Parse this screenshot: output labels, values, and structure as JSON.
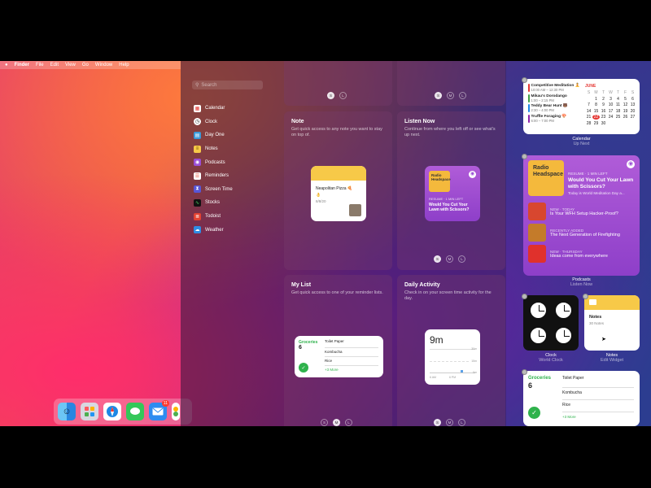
{
  "menubar": {
    "apple": "",
    "items": [
      "Finder",
      "File",
      "Edit",
      "View",
      "Go",
      "Window",
      "Help"
    ]
  },
  "sidebar": {
    "search_placeholder": "Search",
    "items": [
      {
        "label": "Calendar",
        "icon": "calendar-icon",
        "color": "#f4f4f4"
      },
      {
        "label": "Clock",
        "icon": "clock-icon",
        "color": "#111111"
      },
      {
        "label": "Day One",
        "icon": "day-one-icon",
        "color": "#3a9ad9"
      },
      {
        "label": "Notes",
        "icon": "notes-icon",
        "color": "#f7c948"
      },
      {
        "label": "Podcasts",
        "icon": "podcasts-icon",
        "color": "#9b4fd6"
      },
      {
        "label": "Reminders",
        "icon": "reminders-icon",
        "color": "#ffffff"
      },
      {
        "label": "Screen Time",
        "icon": "hourglass-icon",
        "color": "#5856d6"
      },
      {
        "label": "Stocks",
        "icon": "stocks-icon",
        "color": "#111111"
      },
      {
        "label": "Todoist",
        "icon": "todoist-icon",
        "color": "#e44332"
      },
      {
        "label": "Weather",
        "icon": "weather-icon",
        "color": "#2f8de4"
      }
    ]
  },
  "sizes": {
    "s": "S",
    "m": "M",
    "l": "L"
  },
  "panels": {
    "note": {
      "title": "Note",
      "desc": "Get quick access to any note you want to stay on top of."
    },
    "listen": {
      "title": "Listen Now",
      "desc": "Continue from where you left off or see what's up next."
    },
    "mylist": {
      "title": "My List",
      "desc": "Get quick access to one of your reminder lists."
    },
    "activity": {
      "title": "Daily Activity",
      "desc": "Check in on your screen time activity for the day."
    }
  },
  "note_widget": {
    "title": "Neapolitan Pizza 🍕",
    "emoji": "👌",
    "date": "8/8/20"
  },
  "listen_widget": {
    "meta": "RESUME · 1 MIN LEFT",
    "title": "Would You Cut Your Lawn with Scissors?",
    "art": "Radio Headspace"
  },
  "list_widget": {
    "name": "Groceries",
    "count": "6",
    "items": [
      "Toilet Paper",
      "Kombucha",
      "Rice"
    ],
    "more": "+3 More"
  },
  "activity_widget": {
    "value": "9m",
    "ticks": [
      "30m",
      "15m",
      "0m"
    ],
    "times": [
      "6 AM",
      "6 PM"
    ]
  },
  "calendar_widget": {
    "month": "JUNE",
    "weekdays": [
      "S",
      "M",
      "T",
      "W",
      "T",
      "F",
      "S"
    ],
    "days": [
      "",
      "1",
      "2",
      "3",
      "4",
      "5",
      "6",
      "7",
      "8",
      "9",
      "10",
      "11",
      "12",
      "13",
      "14",
      "15",
      "16",
      "17",
      "18",
      "19",
      "20",
      "21",
      "22",
      "23",
      "24",
      "25",
      "26",
      "27",
      "28",
      "29",
      "30",
      "",
      "",
      "",
      ""
    ],
    "today": "22",
    "events": [
      {
        "title": "Competitive Meditation 🧘",
        "time": "10:00 AM – 12:30 PM",
        "color": "#e53935"
      },
      {
        "title": "Mikau's Dorodango",
        "time": "1:00 – 2:15 PM",
        "color": "#43a047"
      },
      {
        "title": "Teddy Bear Hunt 🐻",
        "time": "2:30 – 4:00 PM",
        "color": "#1e88e5"
      },
      {
        "title": "Truffle Foraging 🍄",
        "time": "6:00 – 7:00 PM",
        "color": "#8e24aa"
      }
    ],
    "caption": "Calendar",
    "sub": "Up Next"
  },
  "podcasts_widget": {
    "art": "Radio Headspace",
    "top_meta": "RESUME · 1 MIN LEFT",
    "top_title": "Would You Cut Your Lawn with Scissors?",
    "top_sub": "Today is World Meditation Day a...",
    "rows": [
      {
        "meta": "NEW · TODAY",
        "title": "Is Your WFH Setup Hacker-Proof?",
        "color": "#d8472f"
      },
      {
        "meta": "RECENTLY ADDED",
        "title": "The Next Generation of Firefighting",
        "color": "#c47b2a"
      },
      {
        "meta": "NEW · THURSDAY",
        "title": "Ideas come from everywhere",
        "color": "#e0312c"
      }
    ],
    "caption": "Podcasts",
    "sub": "Listen Now"
  },
  "clock_widget": {
    "caption": "Clock",
    "sub": "World Clock"
  },
  "notes_widget": {
    "title": "Notes",
    "count": "30 Notes",
    "caption": "Notes",
    "sub": "Edit Widget"
  },
  "reminders_widget": {
    "name": "Groceries",
    "count": "6",
    "items": [
      "Toilet Paper",
      "Kombucha",
      "Rice"
    ],
    "more": "+3 More"
  },
  "dock": {
    "mail_badge": "11"
  }
}
